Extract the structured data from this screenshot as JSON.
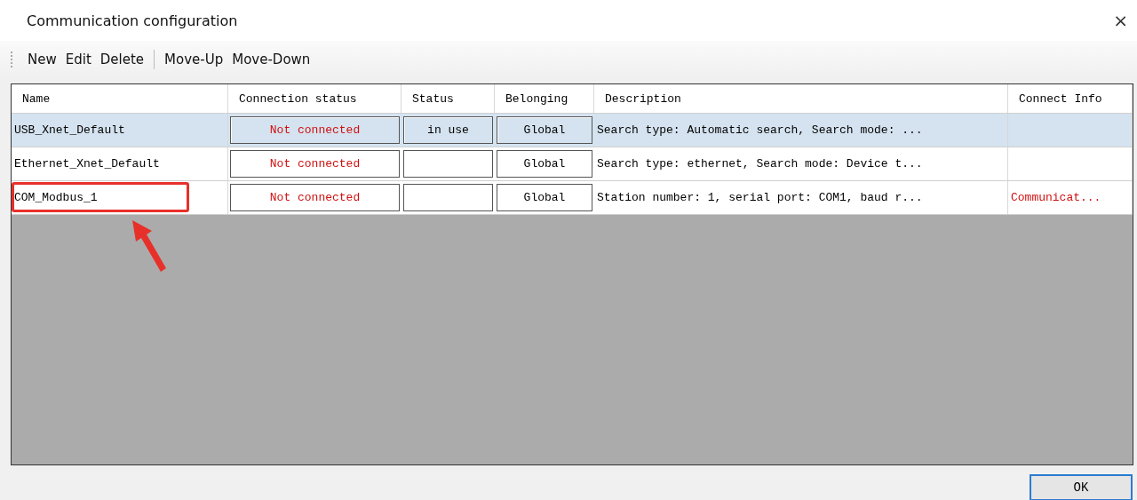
{
  "window": {
    "title": "Communication configuration",
    "close": "×"
  },
  "toolbar": [
    {
      "kind": "button",
      "label": "New"
    },
    {
      "kind": "button",
      "label": "Edit"
    },
    {
      "kind": "button",
      "label": "Delete"
    },
    {
      "kind": "separator"
    },
    {
      "kind": "button",
      "label": "Move-Up"
    },
    {
      "kind": "button",
      "label": "Move-Down"
    }
  ],
  "table": {
    "columns": [
      "Name",
      "Connection status",
      "Status",
      "Belonging",
      "Description",
      "Connect Info"
    ],
    "rows": [
      {
        "name": "USB_Xnet_Default",
        "connection_status": "Not connected",
        "status": "in use",
        "belonging": "Global",
        "description": "Search type: Automatic search, Search mode: ...",
        "connect_info": "",
        "selected": true,
        "highlighted": false
      },
      {
        "name": "Ethernet_Xnet_Default",
        "connection_status": "Not connected",
        "status": "",
        "belonging": "Global",
        "description": "Search type: ethernet, Search mode: Device t...",
        "connect_info": "",
        "selected": false,
        "highlighted": false
      },
      {
        "name": "COM_Modbus_1",
        "connection_status": "Not connected",
        "status": "",
        "belonging": "Global",
        "description": "Station number: 1, serial port: COM1, baud r...",
        "connect_info": "Communicat...",
        "selected": false,
        "highlighted": true
      }
    ]
  },
  "buttons": [
    "OK"
  ]
}
